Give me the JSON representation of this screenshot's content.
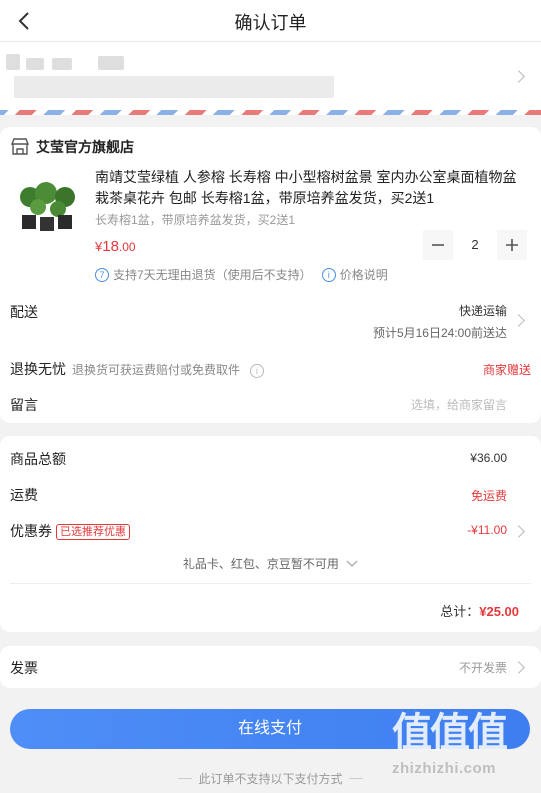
{
  "header": {
    "title": "确认订单"
  },
  "shop": {
    "name": "艾莹官方旗舰店"
  },
  "product": {
    "name": "南靖艾莹绿植 人参榕 长寿榕 中小型榕树盆景 室内办公室桌面植物盆栽茶桌花卉 包邮 长寿榕1盆，带原培养盆发货，买2送1",
    "spec": "长寿榕1盆，带原培养盆发货，买2送1",
    "price_symbol": "¥",
    "price_int": "18",
    "price_dec": ".00",
    "quantity": "2",
    "service_badge": "7",
    "service_text": "支持7天无理由退货（使用后不支持）",
    "price_note_badge": "i",
    "price_note": "价格说明"
  },
  "delivery": {
    "label": "配送",
    "method": "快递运输",
    "eta": "预计5月16日24:00前送达"
  },
  "return": {
    "label": "退换无忧",
    "hint": "退换货可获运费赔付或免费取件",
    "value": "商家赠送"
  },
  "message": {
    "label": "留言",
    "placeholder": "选填，给商家留言"
  },
  "summary": {
    "goods_total_label": "商品总额",
    "goods_total_value": "¥36.00",
    "shipping_label": "运费",
    "shipping_value": "免运费",
    "coupon_label": "优惠券",
    "coupon_tag": "已选推荐优惠",
    "coupon_value": "-¥11.00",
    "giftcard_note": "礼品卡、红包、京豆暂不可用",
    "total_label": "总计：",
    "total_value": "¥25.00"
  },
  "invoice": {
    "label": "发票",
    "value": "不开发票"
  },
  "pay": {
    "button": "在线支付",
    "note": "此订单不支持以下支付方式"
  },
  "watermark": {
    "logo": "值值值",
    "site": "zhizhizhi.com"
  },
  "colors": {
    "accent": "#e4393c",
    "pay_button": "#3d7ef0",
    "stripe_red": "#e97a7a",
    "stripe_blue": "#8ab0e6"
  }
}
